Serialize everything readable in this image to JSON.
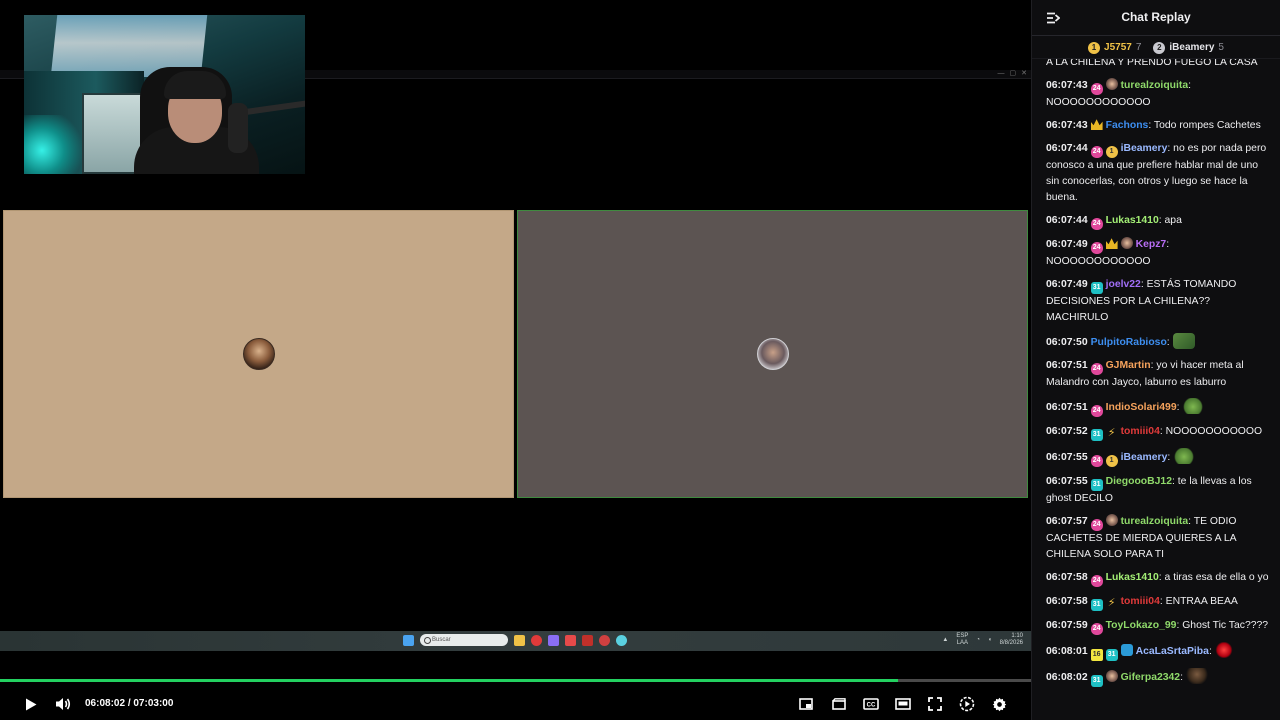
{
  "player": {
    "current_time": "06:08:02",
    "separator": "/",
    "duration": "07:03:00",
    "progress": 0.871
  },
  "taskbar": {
    "search_placeholder": "Buscar",
    "tray_lang": "ESP\nLAA",
    "tray_time": "1:10\n8/8/2026"
  },
  "chat": {
    "title": "Chat Replay",
    "leaderboard": [
      {
        "rank": "1",
        "name": "J5757",
        "score": "7",
        "color": "#f0c247"
      },
      {
        "rank": "2",
        "name": "iBeamery",
        "score": "5",
        "color": "#e6e6ea"
      }
    ],
    "partial_top": "A LA CHILENA Y PRENDO FUEGO LA CASA",
    "messages": [
      {
        "time": "06:07:43",
        "badges": [
          "sub",
          "face"
        ],
        "user": "turealzoiquita",
        "color": "#8fd96a",
        "text": "NOOOOOOOOOOOO"
      },
      {
        "time": "06:07:43",
        "badges": [
          "crown"
        ],
        "user": "Fachons",
        "color": "#3d8ef0",
        "text": "Todo rompes Cachetes"
      },
      {
        "time": "06:07:44",
        "badges": [
          "sub",
          "gold"
        ],
        "user": "iBeamery",
        "color": "#9ab9ff",
        "text": "no es por nada pero conosco a una que prefiere hablar mal de uno sin conocerlas, con otros y luego se hace la buena."
      },
      {
        "time": "06:07:44",
        "badges": [
          "sub"
        ],
        "user": "Lukas1410",
        "color": "#a3ee75",
        "text": "apa"
      },
      {
        "time": "06:07:49",
        "badges": [
          "sub",
          "crown",
          "face"
        ],
        "user": "Kepz7",
        "color": "#b86ef5",
        "text": "NOOOOOOOOOOOO"
      },
      {
        "time": "06:07:49",
        "badges": [
          "teal"
        ],
        "user": "joelv22",
        "color": "#a06ef5",
        "text": "ESTÁS TOMANDO DECISIONES POR LA CHILENA?? MACHIRULO"
      },
      {
        "time": "06:07:50",
        "badges": [],
        "user": "PulpitoRabioso",
        "color": "#3d8ef0",
        "text": "",
        "emote": "money"
      },
      {
        "time": "06:07:51",
        "badges": [
          "sub"
        ],
        "user": "GJMartin",
        "color": "#f5a25c",
        "text": "yo vi hacer meta al Malandro con Jayco, laburro es laburro"
      },
      {
        "time": "06:07:51",
        "badges": [
          "sub"
        ],
        "user": "IndioSolari499",
        "color": "#f5a25c",
        "text": "",
        "emote": "frog"
      },
      {
        "time": "06:07:52",
        "badges": [
          "teal",
          "bolt"
        ],
        "user": "tomiii04",
        "color": "#e03a3a",
        "text": "NOOOOOOOOOOO"
      },
      {
        "time": "06:07:55",
        "badges": [
          "sub",
          "gold"
        ],
        "user": "iBeamery",
        "color": "#9ab9ff",
        "text": "",
        "emote": "frog"
      },
      {
        "time": "06:07:55",
        "badges": [
          "teal"
        ],
        "user": "DiegoooBJ12",
        "color": "#8fd96a",
        "text": "te la llevas a los ghost DECILO"
      },
      {
        "time": "06:07:57",
        "badges": [
          "sub",
          "face"
        ],
        "user": "turealzoiquita",
        "color": "#8fd96a",
        "text": "TE ODIO CACHETES DE MIERDA QUIERES A LA CHILENA SOLO PARA TI"
      },
      {
        "time": "06:07:58",
        "badges": [
          "sub"
        ],
        "user": "Lukas1410",
        "color": "#a3ee75",
        "text": "a tiras esa de ella o yo"
      },
      {
        "time": "06:07:58",
        "badges": [
          "teal",
          "bolt"
        ],
        "user": "tomiii04",
        "color": "#e03a3a",
        "text": "ENTRAA BEAA"
      },
      {
        "time": "06:07:59",
        "badges": [
          "sub"
        ],
        "user": "ToyLokazo_99",
        "color": "#8fd96a",
        "text": "Ghost Tic Tac????"
      },
      {
        "time": "06:08:01",
        "badges": [
          "yellow",
          "teal",
          "blue"
        ],
        "user": "AcaLaSrtaPiba",
        "color": "#9ab9ff",
        "text": "",
        "emote": "ruby"
      },
      {
        "time": "06:08:02",
        "badges": [
          "teal",
          "face"
        ],
        "user": "Giferpa2342",
        "color": "#8fd96a",
        "text": "",
        "emote": "man"
      }
    ]
  },
  "badge_labels": {
    "sub": "24",
    "teal": "31",
    "yellow": "16",
    "gold": "1"
  },
  "colors": {
    "accent_progress": "#23d160",
    "chat_bg": "#0e0e10",
    "tile1_bg": "#c4a888",
    "tile2_bg": "#5c5452"
  },
  "icons": {
    "play": "play-icon",
    "volume": "volume-icon",
    "pip": "picture-in-picture-icon",
    "clip": "clip-icon",
    "cc": "closed-captions-icon",
    "theatre": "theatre-mode-icon",
    "fullscreen": "fullscreen-icon",
    "speed": "playback-speed-icon",
    "settings": "gear-icon",
    "collapse": "collapse-chat-icon"
  }
}
